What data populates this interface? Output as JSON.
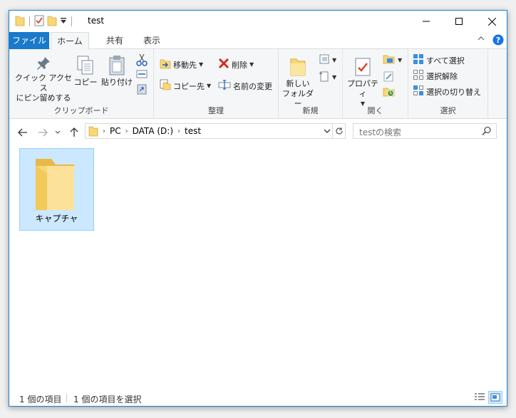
{
  "window": {
    "title": "test"
  },
  "ribbon_tabs": {
    "file": "ファイル",
    "home": "ホーム",
    "share": "共有",
    "view": "表示"
  },
  "ribbon": {
    "clipboard": {
      "pin_line1": "クイック アクセス",
      "pin_line2": "にピン留めする",
      "copy": "コピー",
      "paste": "貼り付け",
      "label": "クリップボード"
    },
    "organize": {
      "move_to": "移動先",
      "copy_to": "コピー先",
      "delete": "削除",
      "rename": "名前の変更",
      "label": "整理"
    },
    "new": {
      "new_folder_line1": "新しい",
      "new_folder_line2": "フォルダー",
      "label": "新規"
    },
    "open": {
      "properties": "プロパティ",
      "label": "開く"
    },
    "select": {
      "select_all": "すべて選択",
      "select_none": "選択解除",
      "invert_selection": "選択の切り替え",
      "label": "選択"
    }
  },
  "address": {
    "crumbs": [
      "PC",
      "DATA (D:)",
      "test"
    ]
  },
  "search": {
    "placeholder": "testの検索"
  },
  "items": [
    {
      "name": "キャプチャ",
      "type": "folder",
      "selected": true
    }
  ],
  "status": {
    "item_count": "1 個の項目",
    "selected_count": "1 個の項目を選択"
  },
  "colors": {
    "accent": "#1979ca",
    "selection": "#cce8ff",
    "folder": "#f8d775"
  }
}
